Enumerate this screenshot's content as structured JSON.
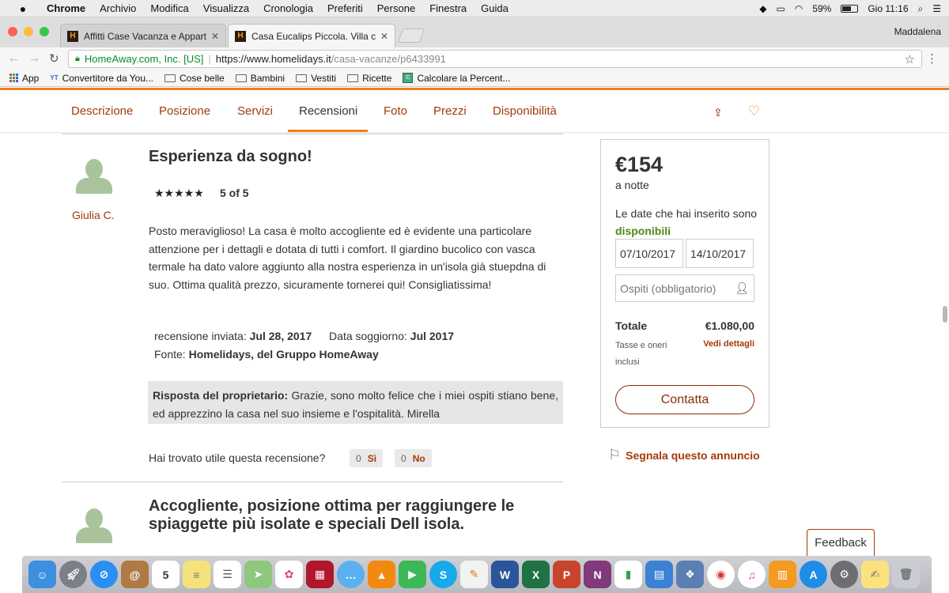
{
  "menubar": {
    "apple": "",
    "items": [
      "Chrome",
      "Archivio",
      "Modifica",
      "Visualizza",
      "Cronologia",
      "Preferiti",
      "Persone",
      "Finestra",
      "Guida"
    ],
    "battery": "59%",
    "clock": "Gio 11:16"
  },
  "tabs": [
    {
      "title": "Affitti Case Vacanza e Apparta",
      "favicon": "H"
    },
    {
      "title": "Casa Eucalips Piccola. Villa co",
      "favicon": "H"
    }
  ],
  "profile": "Maddalena",
  "address": {
    "secure_label": "HomeAway.com, Inc. [US]",
    "url_host": "https://www.homelidays.it",
    "url_path": "/casa-vacanze/p6433991"
  },
  "bookmarks": [
    "App",
    "Convertitore da You...",
    "Cose belle",
    "Bambini",
    "Vestiti",
    "Ricette",
    "Calcolare la Percent..."
  ],
  "page_nav": [
    "Descrizione",
    "Posizione",
    "Servizi",
    "Recensioni",
    "Foto",
    "Prezzi",
    "Disponibilità"
  ],
  "review": {
    "title": "Esperienza da sogno!",
    "stars": "★★★★★",
    "rating": "5 of 5",
    "author": "Giulia C.",
    "body": "Posto meraviglioso! La casa è molto accogliente ed è evidente una particolare attenzione per i dettagli e dotata di tutti i comfort. Il giardino bucolico con vasca termale ha dato valore aggiunto alla nostra esperienza in un'isola già stuepdna di suo. Ottima qualità prezzo, sicuramente tornerei qui! Consigliatissima!",
    "sent_label": "recensione inviata:",
    "sent_date": "Jul 28, 2017",
    "stay_label": "Data soggiorno:",
    "stay_date": "Jul 2017",
    "source_label": "Fonte:",
    "source": "Homelidays, del Gruppo HomeAway",
    "owner_label": "Risposta del proprietario:",
    "owner_reply": "Grazie, sono molto felice che i miei ospiti stiano bene, ed apprezzino la casa nel suo insieme e l'ospitalità. Mirella",
    "helpful_question": "Hai trovato utile questa recensione?",
    "yes_count": "0",
    "yes_label": "Sì",
    "no_count": "0",
    "no_label": "No"
  },
  "review2": {
    "title": "Accogliente, posizione ottima per raggiungere le spiaggette più isolate e speciali Dell isola."
  },
  "booking": {
    "price": "€154",
    "per": "a notte",
    "avail_text": "Le date che hai inserito sono",
    "avail_word": "disponibili",
    "checkin": "07/10/2017",
    "checkout": "14/10/2017",
    "guests_placeholder": "Ospiti (obbligatorio)",
    "total_label": "Totale",
    "total_value": "€1.080,00",
    "taxes_note": "Tasse e oneri inclusi",
    "details_link": "Vedi dettagli",
    "contact_label": "Contatta"
  },
  "report_link": "Segnala questo annuncio",
  "feedback_label": "Feedback",
  "dock": {
    "calendar_day": "5",
    "apps": [
      "finder",
      "launchpad",
      "safari",
      "contacts",
      "calendar",
      "notes",
      "reminders",
      "maps",
      "photos",
      "photo-booth",
      "messages",
      "vlc",
      "facetime",
      "skype",
      "pages",
      "word",
      "excel",
      "powerpoint",
      "onenote",
      "numbers",
      "keynote",
      "preview",
      "chrome",
      "itunes",
      "ibooks",
      "app-store",
      "system-preferences",
      "stickies",
      "trash"
    ]
  },
  "colors": {
    "brand_orange": "#f07f1b",
    "link_brown": "#a23b08",
    "available_green": "#4c8a16"
  }
}
